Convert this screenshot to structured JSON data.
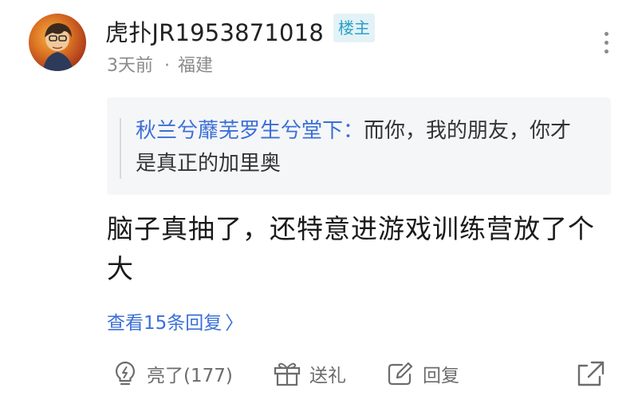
{
  "comment": {
    "username": "虎扑JR1953871018",
    "op_badge": "楼主",
    "time": "3天前",
    "separator": "·",
    "location": "福建",
    "quote": {
      "author": "秋兰兮蘼芜罗生兮堂下",
      "colon": "：",
      "text": "而你，我的朋友，你才是真正的加里奥"
    },
    "body": "脑子真抽了，还特意进游戏训练营放了个大",
    "view_replies": "查看15条回复",
    "view_replies_chevron": "〉"
  },
  "actions": {
    "like_label": "亮了(177)",
    "gift_label": "送礼",
    "reply_label": "回复"
  },
  "icons": {
    "avatar": "user-avatar",
    "more": "more-vertical-icon",
    "like": "lightbulb-icon",
    "gift": "gift-icon",
    "reply": "edit-icon",
    "share": "share-icon"
  },
  "colors": {
    "link": "#3b6fd8",
    "badge_bg": "#e3f2f7",
    "badge_text": "#2ba1c7",
    "quote_bg": "#f5f6f8",
    "muted": "#8a8a8a"
  }
}
